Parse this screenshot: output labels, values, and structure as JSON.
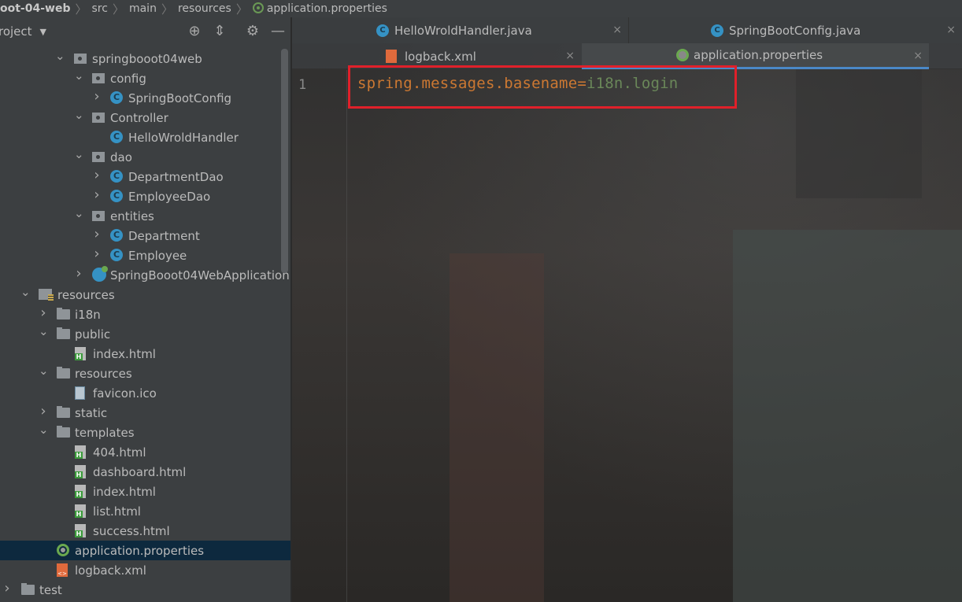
{
  "breadcrumb": {
    "items": [
      "oot-04-web",
      "src",
      "main",
      "resources",
      "application.properties"
    ],
    "separator": "〉"
  },
  "sidebar": {
    "title": "roject",
    "tree": [
      {
        "label": "springbooot04web",
        "icon": "package",
        "expanded": true
      },
      {
        "label": "config",
        "icon": "package",
        "expanded": true
      },
      {
        "label": "SpringBootConfig",
        "icon": "class",
        "expanded": false
      },
      {
        "label": "Controller",
        "icon": "package",
        "expanded": true
      },
      {
        "label": "HelloWroldHandler",
        "icon": "class"
      },
      {
        "label": "dao",
        "icon": "package",
        "expanded": true
      },
      {
        "label": "DepartmentDao",
        "icon": "class",
        "expanded": false
      },
      {
        "label": "EmployeeDao",
        "icon": "class",
        "expanded": false
      },
      {
        "label": "entities",
        "icon": "package",
        "expanded": true
      },
      {
        "label": "Department",
        "icon": "class",
        "expanded": false
      },
      {
        "label": "Employee",
        "icon": "class",
        "expanded": false
      },
      {
        "label": "SpringBooot04WebApplication",
        "icon": "app-class",
        "expanded": false
      },
      {
        "label": "resources",
        "icon": "resources-folder",
        "expanded": true
      },
      {
        "label": "i18n",
        "icon": "folder",
        "expanded": false
      },
      {
        "label": "public",
        "icon": "folder",
        "expanded": true
      },
      {
        "label": "index.html",
        "icon": "html-file"
      },
      {
        "label": "resources",
        "icon": "folder",
        "expanded": true
      },
      {
        "label": "favicon.ico",
        "icon": "ico-file"
      },
      {
        "label": "static",
        "icon": "folder",
        "expanded": false
      },
      {
        "label": "templates",
        "icon": "folder",
        "expanded": true
      },
      {
        "label": "404.html",
        "icon": "html-file"
      },
      {
        "label": "dashboard.html",
        "icon": "html-file"
      },
      {
        "label": "index.html",
        "icon": "html-file"
      },
      {
        "label": "list.html",
        "icon": "html-file"
      },
      {
        "label": "success.html",
        "icon": "html-file"
      },
      {
        "label": "application.properties",
        "icon": "properties-file",
        "selected": true
      },
      {
        "label": "logback.xml",
        "icon": "xml-file"
      },
      {
        "label": "test",
        "icon": "folder",
        "expanded": false
      }
    ]
  },
  "tabs": {
    "row1": [
      {
        "label": "HelloWroldHandler.java",
        "icon": "class"
      },
      {
        "label": "SpringBootConfig.java",
        "icon": "class"
      }
    ],
    "row2": [
      {
        "label": "logback.xml",
        "icon": "xml-file"
      },
      {
        "label": "application.properties",
        "icon": "properties-file",
        "active": true
      }
    ],
    "close_glyph": "×"
  },
  "editor": {
    "line_number": "1",
    "code": {
      "key": "spring.messages.basename",
      "eq": "=",
      "value": "i18n.login"
    }
  },
  "colors": {
    "highlight_box": "#e0202a",
    "key": "#cc7832",
    "value": "#6a8759",
    "selection": "#0d293e"
  }
}
